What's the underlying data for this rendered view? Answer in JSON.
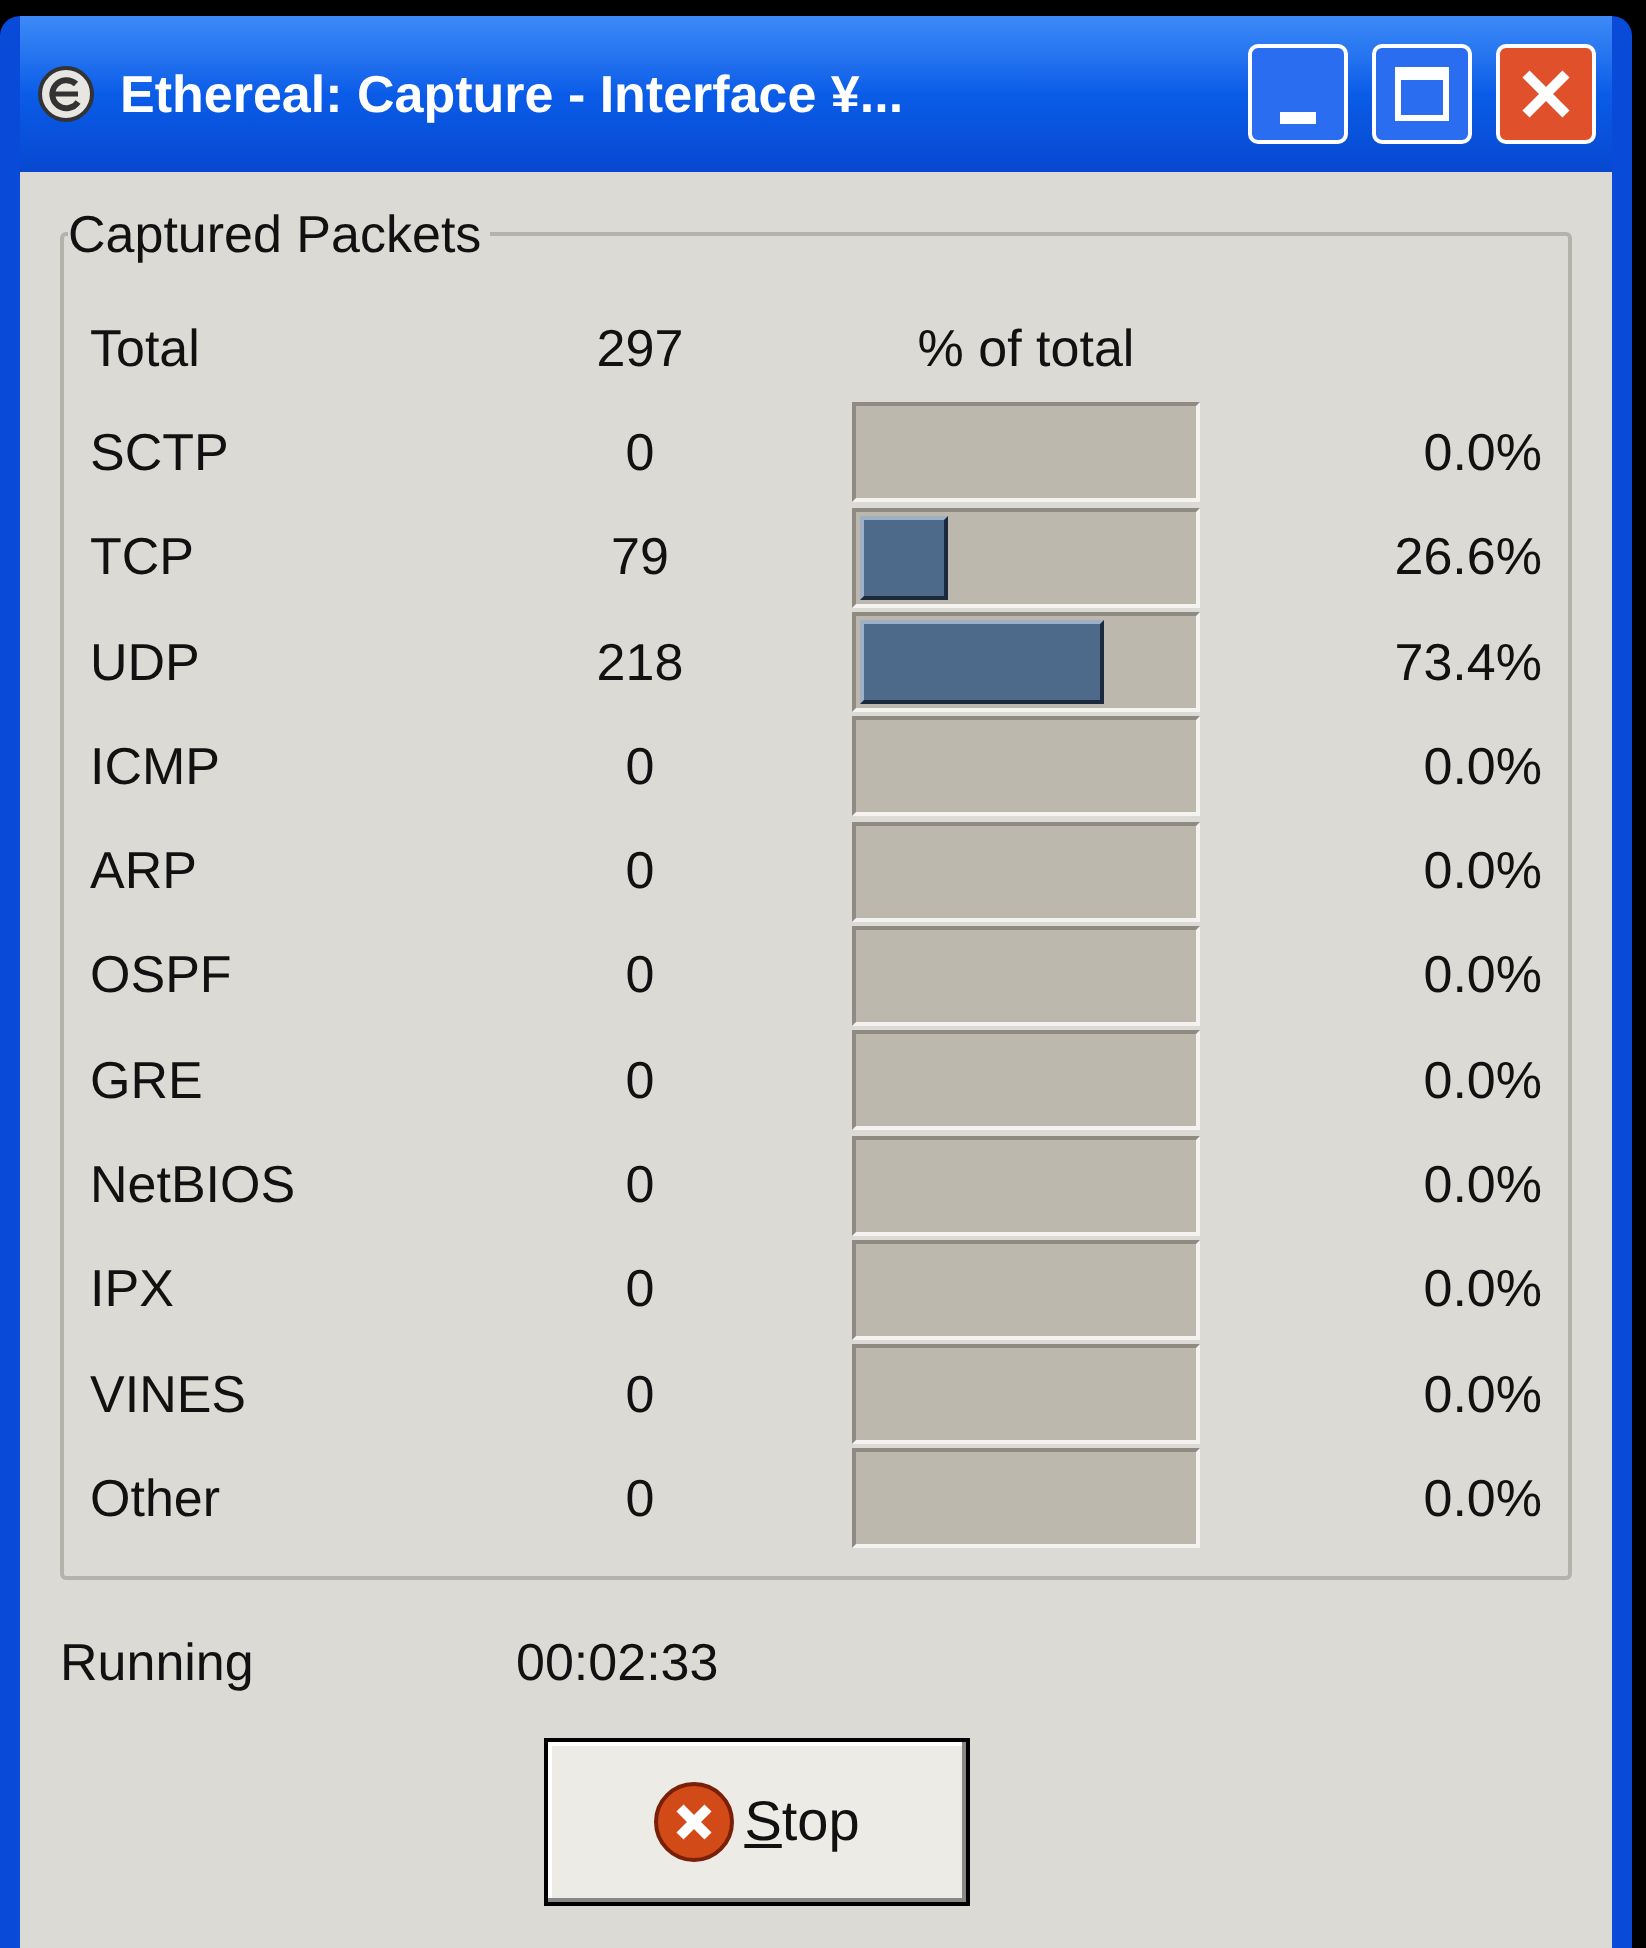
{
  "window": {
    "title": "Ethereal: Capture - Interface ¥..."
  },
  "captured_packets": {
    "title": "Captured Packets",
    "total": {
      "name": "Total",
      "count": "297",
      "percent_heading": "% of total"
    },
    "rows": [
      {
        "name": "SCTP",
        "count": "0",
        "percent": "0.0%"
      },
      {
        "name": "TCP",
        "count": "79",
        "level": 0.266,
        "percent": "26.6%"
      },
      {
        "name": "UDP",
        "count": "218",
        "level": 0.734,
        "percent": "73.4%"
      },
      {
        "name": "ICMP",
        "count": "0",
        "percent": "0.0%"
      },
      {
        "name": "ARP",
        "count": "0",
        "percent": "0.0%"
      },
      {
        "name": "OSPF",
        "count": "0",
        "percent": "0.0%"
      },
      {
        "name": "GRE",
        "count": "0",
        "percent": "0.0%"
      },
      {
        "name": "NetBIOS",
        "count": "0",
        "percent": "0.0%"
      },
      {
        "name": "IPX",
        "count": "0",
        "percent": "0.0%"
      },
      {
        "name": "VINES",
        "count": "0",
        "percent": "0.0%"
      },
      {
        "name": "Other",
        "count": "0",
        "percent": "0.0%"
      }
    ]
  },
  "status": {
    "label": "Running",
    "elapsed": "00:02:33"
  },
  "stop_button": {
    "label": "Stop"
  }
}
